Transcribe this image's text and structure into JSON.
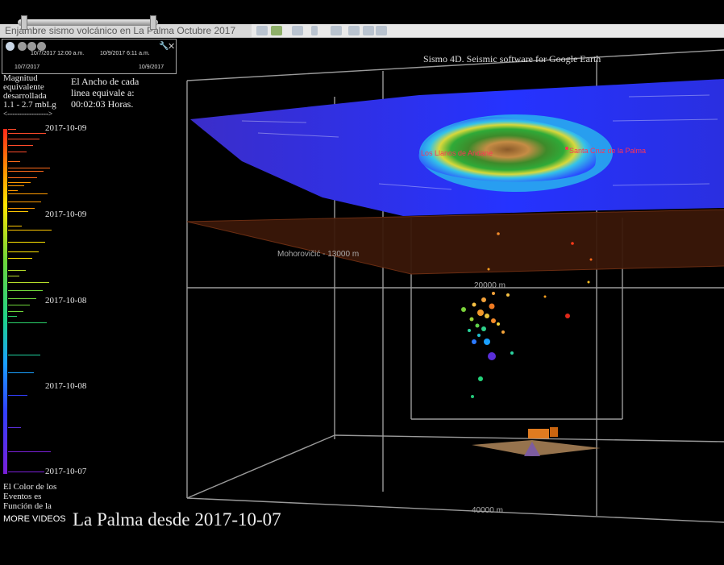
{
  "window": {
    "tab_title": "Enjambre sismo volcánico en La Palma Octubre 2017"
  },
  "time_slider": {
    "start_label": "10/7/2017 12:00 a.m.",
    "end_label": "10/9/2017 6:11 a.m.",
    "range_start": "10/7/2017",
    "range_end": "10/9/2017"
  },
  "legend": {
    "magnitude_title": [
      "Magnitud",
      "equivalente",
      "desarrollada",
      "1.1 - 2.7 mbLg",
      "<----------------->"
    ],
    "dates": [
      "2017-10-09",
      "2017-10-09",
      "2017-10-08",
      "2017-10-08",
      "2017-10-07"
    ],
    "color_note": [
      "El Color de los",
      "Eventos es",
      "Función de la"
    ]
  },
  "width_note": [
    "El Ancho de cada",
    "linea equivale a:",
    "00:02:03 Horas."
  ],
  "software_title": "Sismo 4D. Seismic software for Google Earth",
  "place_labels": {
    "west": "Los Llanos de Aridane",
    "east": "Santa Cruz de la Palma"
  },
  "depth_labels": {
    "moho": "Mohorovičić - 13000 m",
    "d20": "20000 m",
    "d40": "40000 m"
  },
  "bottom_title": "La Palma desde 2017-10-07",
  "more_videos": "MORE VIDEOS",
  "colors": {
    "bg": "#000000",
    "plane": "#3a1708",
    "sea": "#2533ff"
  }
}
